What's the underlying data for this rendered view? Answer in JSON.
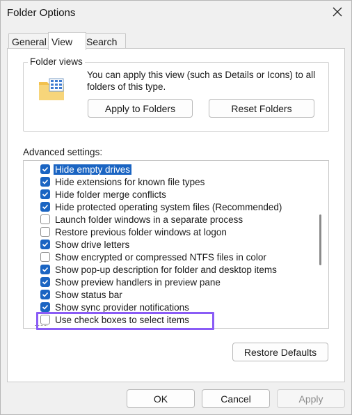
{
  "window": {
    "title": "Folder Options"
  },
  "tabs": [
    {
      "label": "General"
    },
    {
      "label": "View"
    },
    {
      "label": "Search"
    }
  ],
  "folder_views": {
    "legend": "Folder views",
    "description": "You can apply this view (such as Details or Icons) to all folders of this type.",
    "apply_button": "Apply to Folders",
    "reset_button": "Reset Folders",
    "icon": "folder-grid-icon"
  },
  "advanced": {
    "label": "Advanced settings:",
    "items": [
      {
        "label": "Hide empty drives",
        "checked": true,
        "selected": true
      },
      {
        "label": "Hide extensions for known file types",
        "checked": true
      },
      {
        "label": "Hide folder merge conflicts",
        "checked": true
      },
      {
        "label": "Hide protected operating system files (Recommended)",
        "checked": true
      },
      {
        "label": "Launch folder windows in a separate process",
        "checked": false
      },
      {
        "label": "Restore previous folder windows at logon",
        "checked": false
      },
      {
        "label": "Show drive letters",
        "checked": true
      },
      {
        "label": "Show encrypted or compressed NTFS files in color",
        "checked": false
      },
      {
        "label": "Show pop-up description for folder and desktop items",
        "checked": true
      },
      {
        "label": "Show preview handlers in preview pane",
        "checked": true
      },
      {
        "label": "Show status bar",
        "checked": true
      },
      {
        "label": "Show sync provider notifications",
        "checked": true
      },
      {
        "label": "Use check boxes to select items",
        "checked": false
      }
    ]
  },
  "restore_defaults": "Restore Defaults",
  "footer": {
    "ok": "OK",
    "cancel": "Cancel",
    "apply": "Apply"
  },
  "colors": {
    "accent": "#1a64c2",
    "highlight": "#8a5cf6"
  }
}
